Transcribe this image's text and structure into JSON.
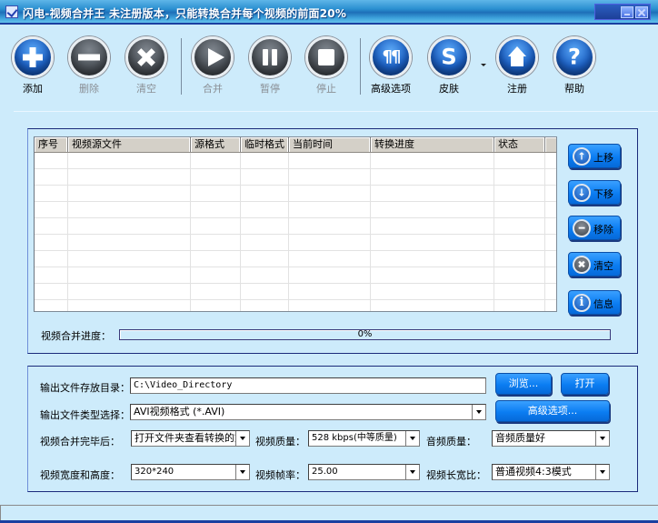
{
  "window": {
    "title": "闪电-视频合并王  未注册版本，只能转换合并每个视频的前面20%"
  },
  "toolbar": {
    "buttons": [
      {
        "id": "add",
        "label": "添加",
        "icon": "plus-icon",
        "enabled": true
      },
      {
        "id": "delete",
        "label": "删除",
        "icon": "minus-icon",
        "enabled": false
      },
      {
        "id": "clear",
        "label": "清空",
        "icon": "x-icon",
        "enabled": false
      },
      {
        "id": "merge",
        "label": "合并",
        "icon": "play-icon",
        "enabled": false
      },
      {
        "id": "pause",
        "label": "暂停",
        "icon": "pause-icon",
        "enabled": false
      },
      {
        "id": "stop",
        "label": "停止",
        "icon": "stop-icon",
        "enabled": false
      },
      {
        "id": "advanced",
        "label": "高级选项",
        "icon": "tools-icon",
        "enabled": true
      },
      {
        "id": "skin",
        "label": "皮肤",
        "icon": "skin-icon",
        "enabled": true
      },
      {
        "id": "register",
        "label": "注册",
        "icon": "home-icon",
        "enabled": true
      },
      {
        "id": "help",
        "label": "帮助",
        "icon": "help-icon",
        "enabled": true
      }
    ]
  },
  "file_table": {
    "columns": [
      "序号",
      "视频源文件",
      "源格式",
      "临时格式",
      "当前时间",
      "转换进度",
      "状态",
      ""
    ],
    "rows": []
  },
  "side_buttons": [
    {
      "id": "move_up",
      "label": "上移",
      "icon": "arrow-up-icon",
      "glyph": "↑"
    },
    {
      "id": "move_down",
      "label": "下移",
      "icon": "arrow-down-icon",
      "glyph": "↓"
    },
    {
      "id": "remove",
      "label": "移除",
      "icon": "minus-icon",
      "glyph": "━"
    },
    {
      "id": "clear",
      "label": "清空",
      "icon": "x-icon",
      "glyph": "✖"
    },
    {
      "id": "info",
      "label": "信息",
      "icon": "info-icon",
      "glyph": "i"
    }
  ],
  "merge_progress": {
    "label": "视频合并进度：",
    "percent": 0,
    "text": "0%"
  },
  "output": {
    "dir_label": "输出文件存放目录：",
    "dir_value": "C:\\Video_Directory",
    "browse_label": "浏览...",
    "open_label": "打开",
    "type_label": "输出文件类型选择：",
    "type_value": "AVI视频格式 (*.AVI)",
    "advanced_label": "高级选项...",
    "after_merge_label": "视频合并完毕后：",
    "after_merge_value": "打开文件夹查看转换的文",
    "video_quality_label": "视频质量：",
    "video_quality_value": "528 kbps(中等质量)",
    "audio_quality_label": "音频质量：",
    "audio_quality_value": "音频质量好",
    "size_label": "视频宽度和高度：",
    "size_value": "320*240",
    "fps_label": "视频帧率：",
    "fps_value": "25.00",
    "aspect_label": "视频长宽比：",
    "aspect_value": "普通视频4:3模式"
  },
  "status_bar": {
    "text": ""
  }
}
